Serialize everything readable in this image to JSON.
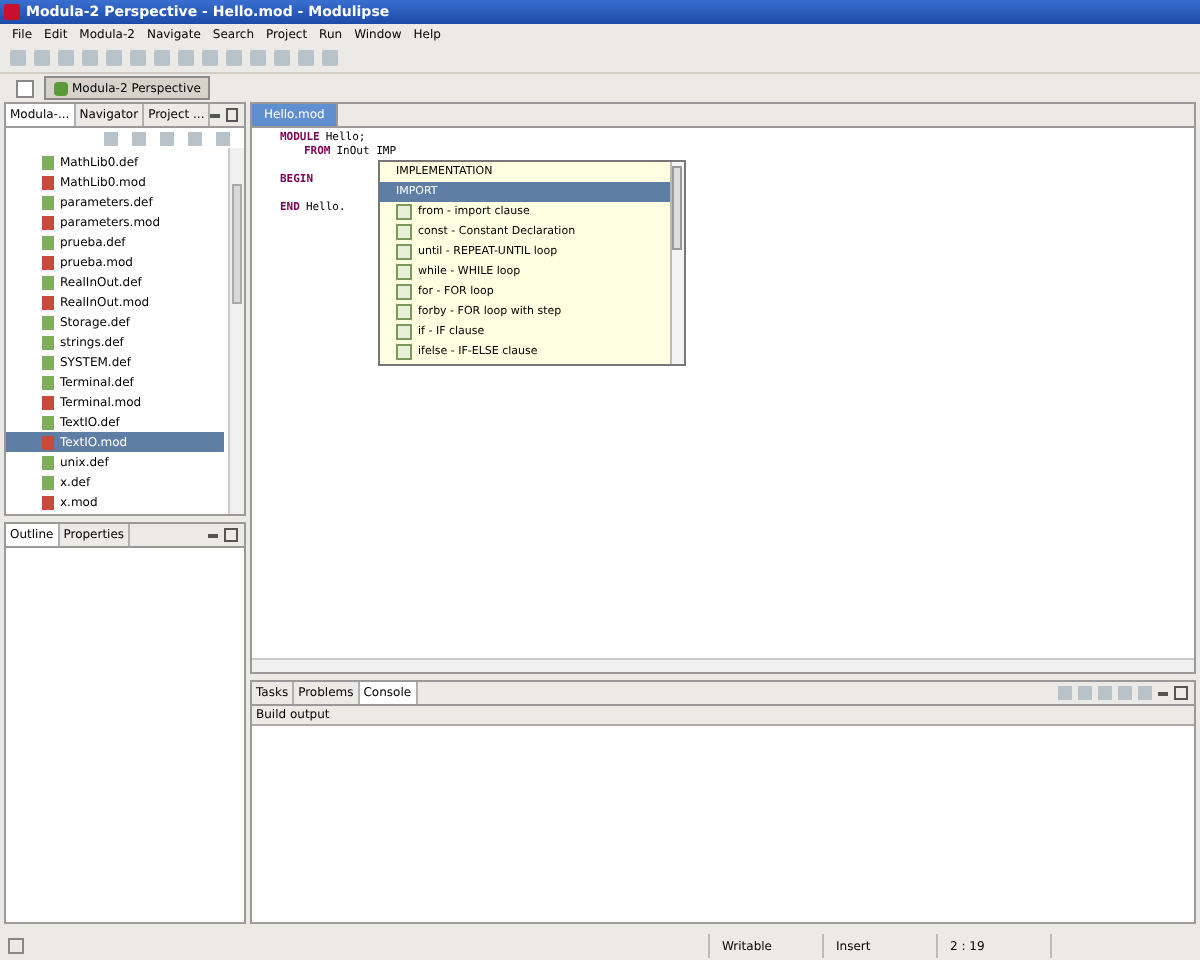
{
  "window": {
    "title": "Modula-2 Perspective - Hello.mod - Modulipse"
  },
  "menu": [
    "File",
    "Edit",
    "Modula-2",
    "Navigate",
    "Search",
    "Project",
    "Run",
    "Window",
    "Help"
  ],
  "perspective": {
    "label": "Modula-2 Perspective",
    "selected": true
  },
  "left_tabs": [
    {
      "label": "Modula-...",
      "selected": true
    },
    {
      "label": "Navigator",
      "selected": false
    },
    {
      "label": "Project ...",
      "selected": false
    }
  ],
  "files": [
    {
      "name": "MathLib0.def",
      "kind": "def",
      "selected": false
    },
    {
      "name": "MathLib0.mod",
      "kind": "mod",
      "selected": false
    },
    {
      "name": "parameters.def",
      "kind": "def",
      "selected": false
    },
    {
      "name": "parameters.mod",
      "kind": "mod",
      "selected": false
    },
    {
      "name": "prueba.def",
      "kind": "def",
      "selected": false
    },
    {
      "name": "prueba.mod",
      "kind": "mod",
      "selected": false
    },
    {
      "name": "RealInOut.def",
      "kind": "def",
      "selected": false
    },
    {
      "name": "RealInOut.mod",
      "kind": "mod",
      "selected": false
    },
    {
      "name": "Storage.def",
      "kind": "def",
      "selected": false
    },
    {
      "name": "strings.def",
      "kind": "def",
      "selected": false
    },
    {
      "name": "SYSTEM.def",
      "kind": "def",
      "selected": false
    },
    {
      "name": "Terminal.def",
      "kind": "def",
      "selected": false
    },
    {
      "name": "Terminal.mod",
      "kind": "mod",
      "selected": false
    },
    {
      "name": "TextIO.def",
      "kind": "def",
      "selected": false
    },
    {
      "name": "TextIO.mod",
      "kind": "mod",
      "selected": true
    },
    {
      "name": "unix.def",
      "kind": "def",
      "selected": false
    },
    {
      "name": "x.def",
      "kind": "def",
      "selected": false
    },
    {
      "name": "x.mod",
      "kind": "mod",
      "selected": false
    }
  ],
  "outline_tabs": [
    {
      "label": "Outline",
      "selected": true
    },
    {
      "label": "Properties",
      "selected": false
    }
  ],
  "editor_tab": {
    "label": "Hello.mod",
    "selected": true
  },
  "code": [
    {
      "kind": "code",
      "keyword": "MODULE",
      "rest": "Hello;",
      "indent": false
    },
    {
      "kind": "code",
      "keyword": "FROM",
      "rest": "InOut IMP",
      "indent": true
    },
    {
      "kind": "blank"
    },
    {
      "kind": "code",
      "keyword": "BEGIN",
      "indent": false
    },
    {
      "kind": "blank"
    },
    {
      "kind": "code",
      "keyword": "END",
      "rest": "Hello.",
      "indent": false
    }
  ],
  "completions": [
    {
      "label": "IMPLEMENTATION",
      "kind": "keyword",
      "selected": false
    },
    {
      "label": "IMPORT",
      "kind": "keyword",
      "selected": true
    },
    {
      "label": "from - import clause",
      "kind": "template",
      "selected": false
    },
    {
      "label": "const - Constant Declaration",
      "kind": "template",
      "selected": false
    },
    {
      "label": "until - REPEAT-UNTIL loop",
      "kind": "template",
      "selected": false
    },
    {
      "label": "while - WHILE loop",
      "kind": "template",
      "selected": false
    },
    {
      "label": "for - FOR loop",
      "kind": "template",
      "selected": false
    },
    {
      "label": "forby - FOR loop with step",
      "kind": "template",
      "selected": false
    },
    {
      "label": "if - IF clause",
      "kind": "template",
      "selected": false
    },
    {
      "label": "ifelse - IF-ELSE clause",
      "kind": "template",
      "selected": false
    }
  ],
  "bottom_tabs": [
    {
      "label": "Tasks",
      "selected": false
    },
    {
      "label": "Problems",
      "selected": false
    },
    {
      "label": "Console",
      "selected": true
    }
  ],
  "console": {
    "title": "Build output"
  },
  "status_bar": [
    "Writable",
    "Insert",
    "2 : 19"
  ]
}
